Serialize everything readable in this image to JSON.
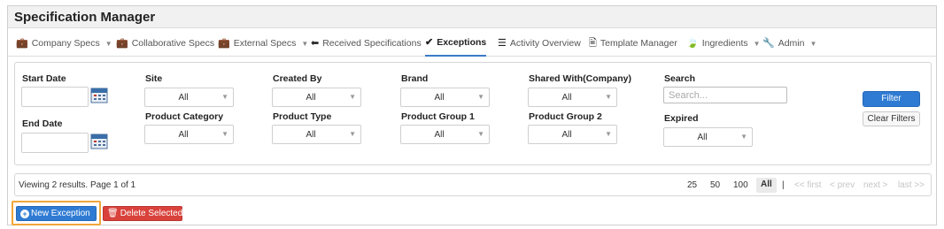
{
  "app": {
    "title": "Specification Manager"
  },
  "nav": {
    "items": [
      {
        "label": "Company Specs",
        "icon": "briefcase-icon",
        "dropdown": true
      },
      {
        "label": "Collaborative Specs",
        "icon": "briefcase-icon",
        "dropdown": false
      },
      {
        "label": "External Specs",
        "icon": "briefcase-icon",
        "dropdown": true
      },
      {
        "label": "Received Specifications",
        "icon": "arrow-left-icon",
        "dropdown": false
      },
      {
        "label": "Exceptions",
        "icon": "check-circle-icon",
        "dropdown": false,
        "active": true
      },
      {
        "label": "Activity Overview",
        "icon": "list-icon",
        "dropdown": false
      },
      {
        "label": "Template Manager",
        "icon": "document-icon",
        "dropdown": false
      },
      {
        "label": "Ingredients",
        "icon": "leaf-icon",
        "dropdown": true
      },
      {
        "label": "Admin",
        "icon": "wrench-icon",
        "dropdown": true
      }
    ]
  },
  "filters": {
    "start_date": {
      "label": "Start Date",
      "value": ""
    },
    "end_date": {
      "label": "End Date",
      "value": ""
    },
    "site": {
      "label": "Site",
      "value": "All"
    },
    "product_category": {
      "label": "Product Category",
      "value": "All"
    },
    "created_by": {
      "label": "Created By",
      "value": "All"
    },
    "product_type": {
      "label": "Product Type",
      "value": "All"
    },
    "brand": {
      "label": "Brand",
      "value": "All"
    },
    "product_group_1": {
      "label": "Product Group 1",
      "value": "All"
    },
    "shared_with": {
      "label": "Shared With(Company)",
      "value": "All"
    },
    "product_group_2": {
      "label": "Product Group 2",
      "value": "All"
    },
    "search": {
      "label": "Search",
      "placeholder": "Search...",
      "value": ""
    },
    "expired": {
      "label": "Expired",
      "value": "All"
    },
    "filter_button": "Filter",
    "clear_button": "Clear Filters"
  },
  "results": {
    "text": "Viewing 2 results. Page 1 of 1",
    "page_sizes": [
      "25",
      "50",
      "100",
      "All"
    ],
    "active_page_size": "All",
    "separator": "|",
    "paging": [
      "<< first",
      "< prev",
      "next >",
      "last >>"
    ]
  },
  "actions": {
    "new_exception": "New Exception",
    "delete_selected": "Delete Selected"
  },
  "colors": {
    "primary": "#2f7bd3",
    "danger": "#d9423b",
    "highlight": "#f0a63a",
    "active_tab_underline": "#3a7bc8"
  }
}
